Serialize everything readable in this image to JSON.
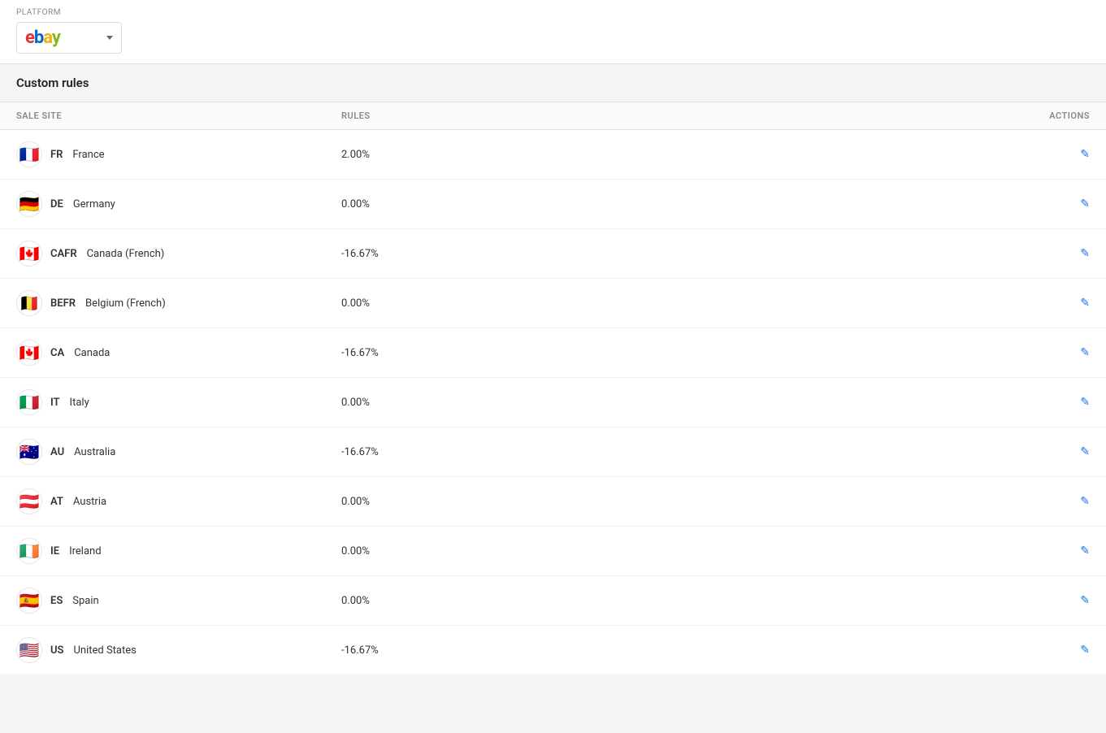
{
  "header": {
    "platform_label": "PLATFORM",
    "platform_value": "ebay",
    "ebay_logo": "ebay",
    "dropdown_icon": "chevron-down"
  },
  "section": {
    "title": "Custom rules"
  },
  "table": {
    "columns": [
      {
        "key": "sale_site",
        "label": "SALE SITE"
      },
      {
        "key": "rules",
        "label": "RULES"
      },
      {
        "key": "actions",
        "label": "ACTIONS"
      }
    ],
    "rows": [
      {
        "flag": "fr",
        "flag_emoji": "🇫🇷",
        "code": "FR",
        "name": "France",
        "rules": "2.00%"
      },
      {
        "flag": "de",
        "flag_emoji": "🇩🇪",
        "code": "DE",
        "name": "Germany",
        "rules": "0.00%"
      },
      {
        "flag": "ca",
        "flag_emoji": "🇨🇦",
        "code": "CAFR",
        "name": "Canada (French)",
        "rules": "-16.67%"
      },
      {
        "flag": "be",
        "flag_emoji": "🇧🇪",
        "code": "BEFR",
        "name": "Belgium (French)",
        "rules": "0.00%"
      },
      {
        "flag": "ca",
        "flag_emoji": "🇨🇦",
        "code": "CA",
        "name": "Canada",
        "rules": "-16.67%"
      },
      {
        "flag": "it",
        "flag_emoji": "🇮🇹",
        "code": "IT",
        "name": "Italy",
        "rules": "0.00%"
      },
      {
        "flag": "au",
        "flag_emoji": "🇦🇺",
        "code": "AU",
        "name": "Australia",
        "rules": "-16.67%"
      },
      {
        "flag": "at",
        "flag_emoji": "🇦🇹",
        "code": "AT",
        "name": "Austria",
        "rules": "0.00%"
      },
      {
        "flag": "ie",
        "flag_emoji": "🇮🇪",
        "code": "IE",
        "name": "Ireland",
        "rules": "0.00%"
      },
      {
        "flag": "es",
        "flag_emoji": "🇪🇸",
        "code": "ES",
        "name": "Spain",
        "rules": "0.00%"
      },
      {
        "flag": "us",
        "flag_emoji": "🇺🇸",
        "code": "US",
        "name": "United States",
        "rules": "-16.67%"
      }
    ],
    "edit_icon": "✎"
  }
}
